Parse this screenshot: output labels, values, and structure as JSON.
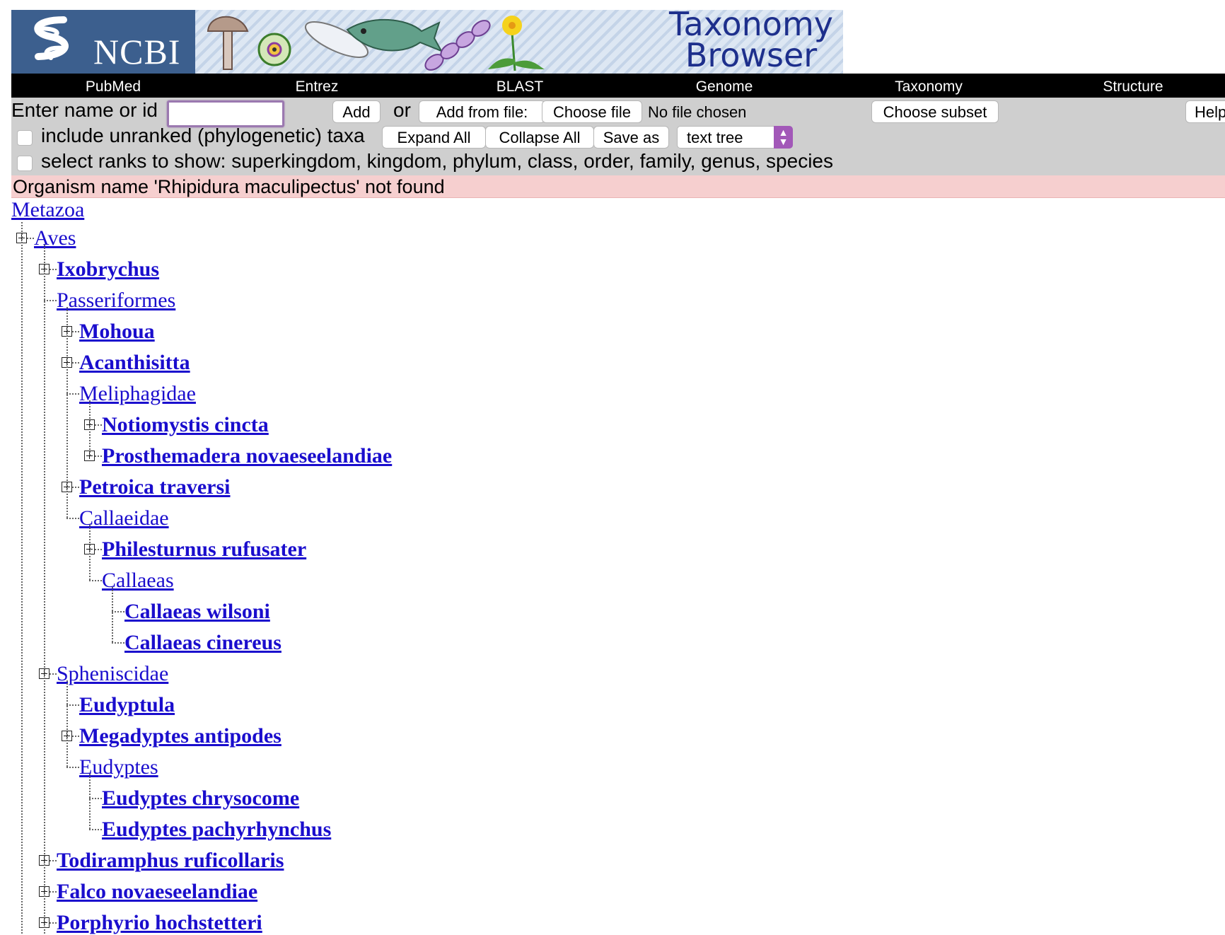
{
  "banner": {
    "logo_text": "NCBI",
    "title_line1": "Taxonomy",
    "title_line2": "Browser"
  },
  "nav": [
    "PubMed",
    "Entrez",
    "BLAST",
    "Genome",
    "Taxonomy",
    "Structure"
  ],
  "toolbar": {
    "enter_label": "Enter name or id",
    "name_input_value": "",
    "add_button": "Add",
    "or_label": "or",
    "add_from_file_button": "Add from file:",
    "choose_file_button": "Choose file",
    "no_file_text": "No file chosen",
    "choose_subset_button": "Choose subset",
    "help_button": "Help",
    "unranked_label": "include unranked (phylogenetic) taxa",
    "expand_all_button": "Expand All",
    "collapse_all_button": "Collapse All",
    "save_as_button": "Save as",
    "format_select_value": "text tree",
    "ranks_label": "select ranks to show: superkingdom, kingdom, phylum, class, order, family, genus, species"
  },
  "error_message": "Organism name 'Rhipidura maculipectus' not found",
  "tree": {
    "root": "Metazoa",
    "nodes": [
      {
        "label": "Aves",
        "bold": false,
        "expandable": true
      },
      {
        "label": "Ixobrychus",
        "bold": true,
        "expandable": true
      },
      {
        "label": "Passeriformes",
        "bold": false,
        "expandable": false
      },
      {
        "label": "Mohoua",
        "bold": true,
        "expandable": true
      },
      {
        "label": "Acanthisitta",
        "bold": true,
        "expandable": true
      },
      {
        "label": "Meliphagidae",
        "bold": false,
        "expandable": false
      },
      {
        "label": "Notiomystis cincta",
        "bold": true,
        "expandable": true
      },
      {
        "label": "Prosthemadera novaeseelandiae",
        "bold": true,
        "expandable": true
      },
      {
        "label": "Petroica traversi",
        "bold": true,
        "expandable": true
      },
      {
        "label": "Callaeidae",
        "bold": false,
        "expandable": false
      },
      {
        "label": "Philesturnus rufusater",
        "bold": true,
        "expandable": true
      },
      {
        "label": "Callaeas",
        "bold": false,
        "expandable": false
      },
      {
        "label": "Callaeas wilsoni",
        "bold": true,
        "expandable": false
      },
      {
        "label": "Callaeas cinereus",
        "bold": true,
        "expandable": false
      },
      {
        "label": "Spheniscidae",
        "bold": false,
        "expandable": true
      },
      {
        "label": "Eudyptula",
        "bold": true,
        "expandable": false
      },
      {
        "label": "Megadyptes antipodes",
        "bold": true,
        "expandable": true
      },
      {
        "label": "Eudyptes",
        "bold": false,
        "expandable": false
      },
      {
        "label": "Eudyptes chrysocome",
        "bold": true,
        "expandable": false
      },
      {
        "label": "Eudyptes pachyrhynchus",
        "bold": true,
        "expandable": false
      },
      {
        "label": "Todiramphus ruficollaris",
        "bold": true,
        "expandable": true
      },
      {
        "label": "Falco novaeseelandiae",
        "bold": true,
        "expandable": true
      },
      {
        "label": "Porphyrio hochstetteri",
        "bold": true,
        "expandable": true
      }
    ]
  },
  "colors": {
    "link": "#1a0dcd",
    "logo_bg": "#3c5f8e",
    "navbar_bg": "#000000",
    "toolbar_bg": "#cfcfcf",
    "error_bg": "#f6cfcf",
    "select_accent": "#a258b8",
    "title": "#1d2f8c"
  }
}
